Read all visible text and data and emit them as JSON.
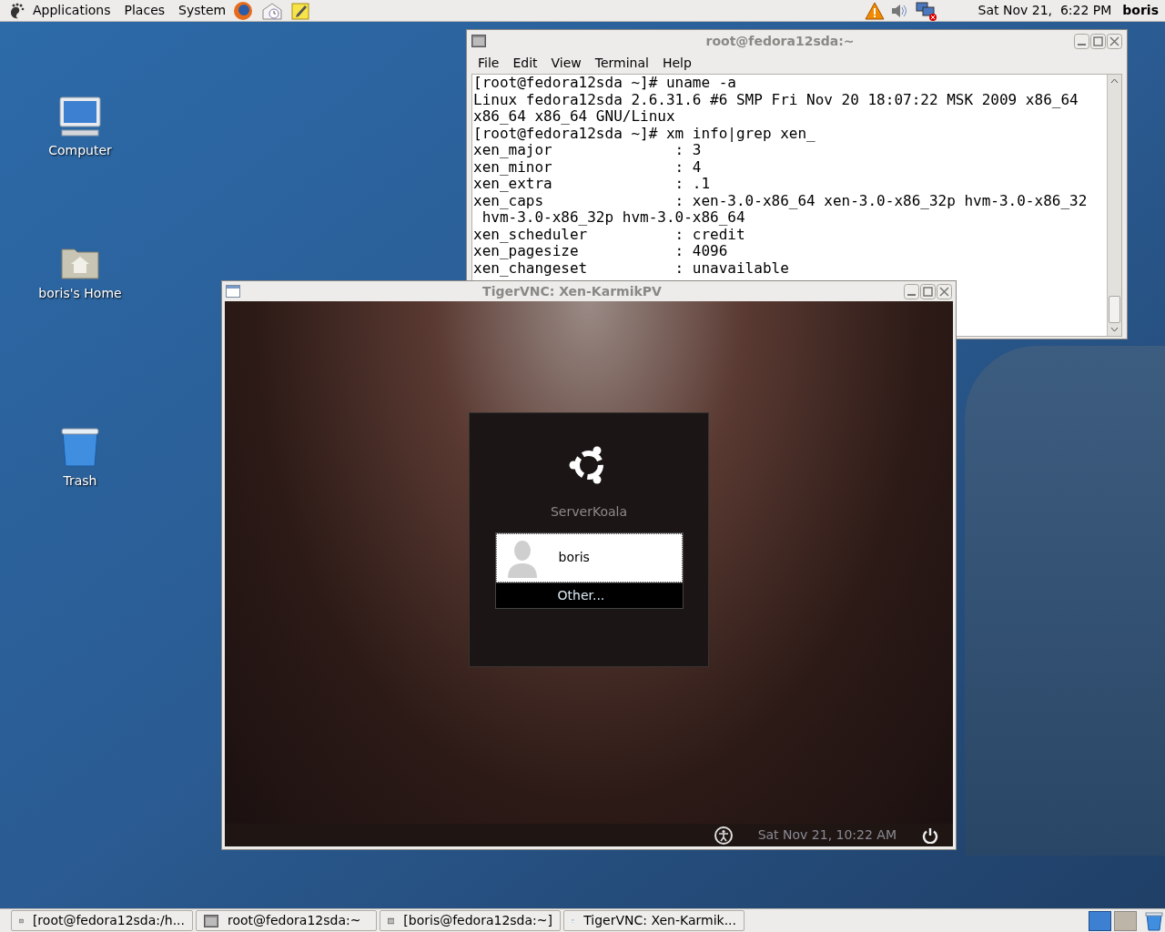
{
  "top_panel": {
    "menus": [
      "Applications",
      "Places",
      "System"
    ],
    "clock": "Sat Nov 21,  6:22 PM",
    "user": "boris"
  },
  "desktop_icons": [
    {
      "label": "Computer",
      "kind": "computer"
    },
    {
      "label": "boris's Home",
      "kind": "home"
    },
    {
      "label": "Trash",
      "kind": "trash"
    }
  ],
  "terminal": {
    "title": "root@fedora12sda:~",
    "menu": [
      "File",
      "Edit",
      "View",
      "Terminal",
      "Help"
    ],
    "lines": [
      "[root@fedora12sda ~]# uname -a",
      "Linux fedora12sda 2.6.31.6 #6 SMP Fri Nov 20 18:07:22 MSK 2009 x86_64",
      "x86_64 x86_64 GNU/Linux",
      "[root@fedora12sda ~]# xm info|grep xen_",
      "xen_major              : 3",
      "xen_minor              : 4",
      "xen_extra              : .1",
      "xen_caps               : xen-3.0-x86_64 xen-3.0-x86_32p hvm-3.0-x86_32",
      " hvm-3.0-x86_32p hvm-3.0-x86_64",
      "xen_scheduler          : credit",
      "xen_pagesize           : 4096",
      "xen_changeset          : unavailable"
    ]
  },
  "vnc": {
    "title": "TigerVNC: Xen-KarmikPV",
    "hostname": "ServerKoala",
    "users": [
      {
        "name": "boris",
        "selected": true,
        "kind": "user"
      },
      {
        "name": "Other...",
        "selected": false,
        "kind": "other"
      }
    ],
    "clock": "Sat Nov 21, 10:22 AM"
  },
  "taskbar": [
    {
      "label": "[root@fedora12sda:/h...",
      "selected": false,
      "kind": "terminal"
    },
    {
      "label": "root@fedora12sda:~",
      "selected": false,
      "kind": "terminal"
    },
    {
      "label": "[boris@fedora12sda:~]",
      "selected": false,
      "kind": "terminal"
    },
    {
      "label": "TigerVNC: Xen-Karmik...",
      "selected": false,
      "kind": "window"
    }
  ],
  "workspaces": [
    {
      "selected": true
    },
    {
      "selected": false
    }
  ]
}
